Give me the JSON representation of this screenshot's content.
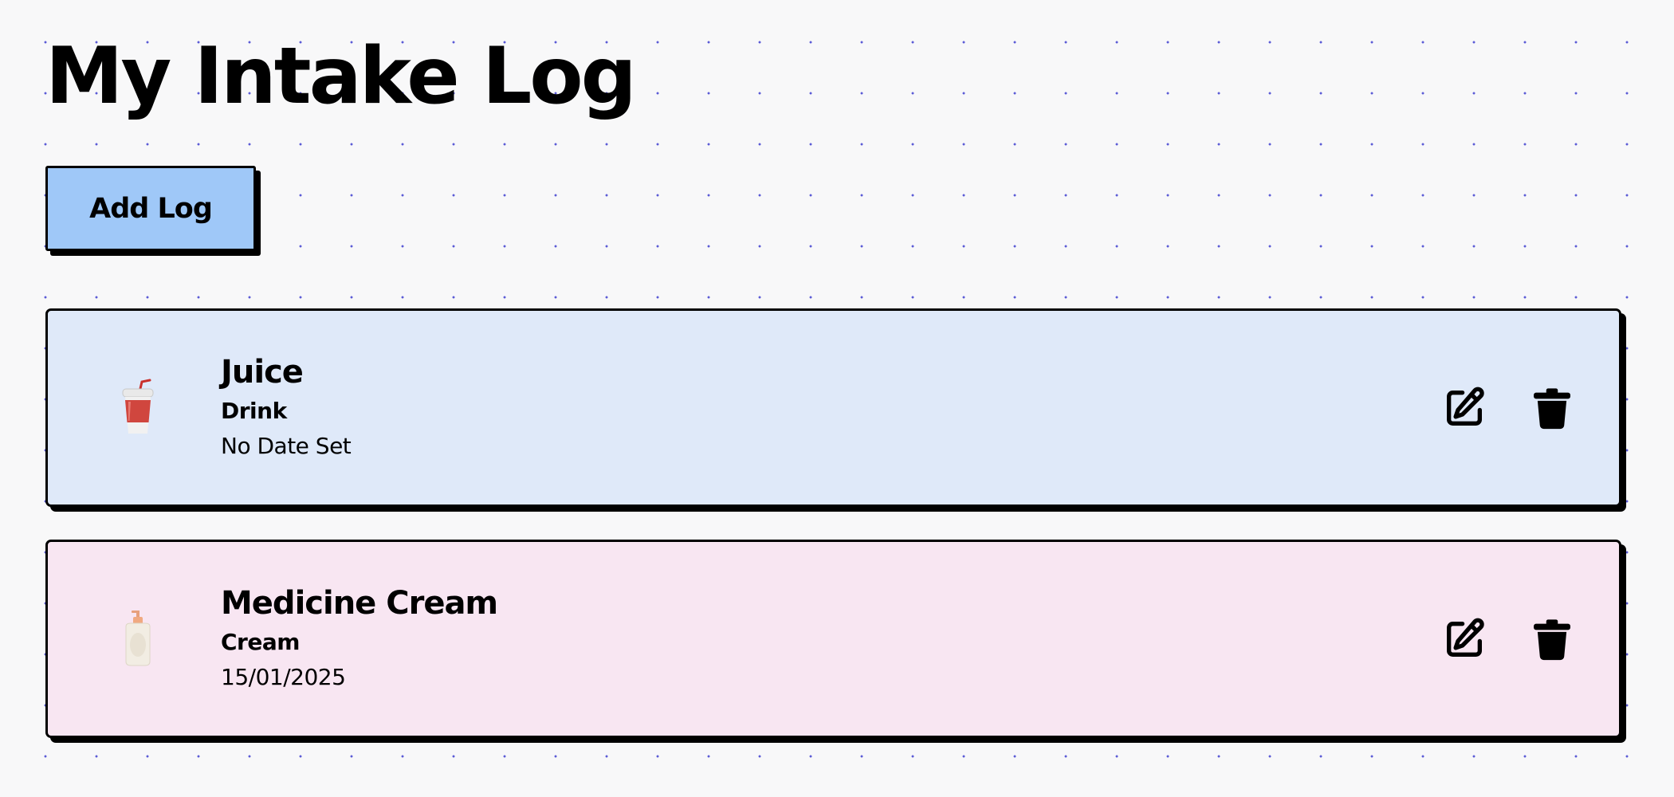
{
  "header": {
    "title": "My Intake Log"
  },
  "toolbar": {
    "add_label": "Add Log"
  },
  "logs": [
    {
      "name": "Juice",
      "category": "Drink",
      "date": "No Date Set",
      "icon": "drink-cup-icon",
      "background": "#dfe9f9"
    },
    {
      "name": "Medicine Cream",
      "category": "Cream",
      "date": "15/01/2025",
      "icon": "lotion-bottle-icon",
      "background": "#f8e6f2"
    }
  ],
  "actions": {
    "edit_icon": "edit-pencil-icon",
    "delete_icon": "trash-icon"
  },
  "colors": {
    "page_background": "#f8f8f9",
    "dot_grid": "#5b5bd6",
    "add_button": "#9fc8f8",
    "border": "#000000"
  }
}
